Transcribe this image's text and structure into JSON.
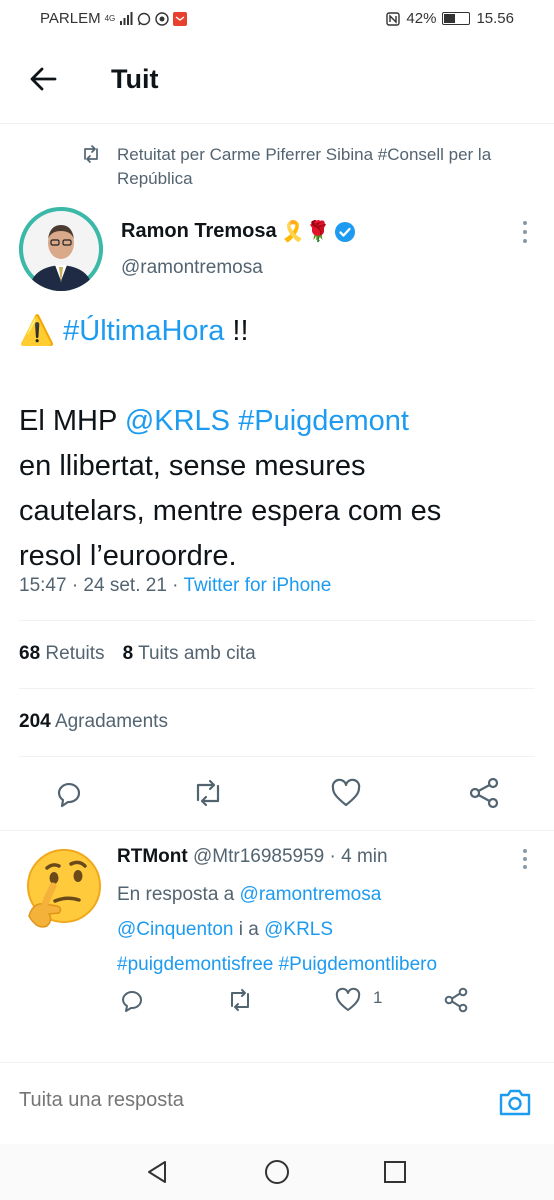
{
  "status_bar": {
    "carrier": "PARLEM",
    "network": "4G",
    "battery": "42%",
    "battery_level": 0.42,
    "time": "15.56"
  },
  "header": {
    "title": "Tuit"
  },
  "retweet": {
    "text": "Retuitat per Carme Piferrer Sibina #Consell per la República"
  },
  "tweet": {
    "author_name": "Ramon Tremosa",
    "author_emoji": "🎗️🌹",
    "author_handle": "@ramontremosa",
    "warning_emoji": "⚠️",
    "hashtag_breaking": "#ÚltimaHora",
    "exclaim": " !!",
    "line2_prefix": "El MHP ",
    "mention_krls": "@KRLS",
    "hashtag_puigdemont": "#Puigdemont",
    "line3": "en llibertat, sense mesures",
    "line4": "cautelars, mentre espera com es",
    "line5": "resol l’euroordre.",
    "meta_time": "15:47 · 24 set. 21 · ",
    "meta_source": "Twitter for iPhone"
  },
  "stats": {
    "retweets_count": "68",
    "retweets_label": "Retuits",
    "quotes_count": "8",
    "quotes_label": "Tuits amb cita",
    "likes_count": "204",
    "likes_label": "Agradaments"
  },
  "reply": {
    "author_name": "RTMont",
    "author_handle": "@Mtr16985959",
    "time": " · 4 min",
    "in_reply_prefix": "En resposta a ",
    "mention1": "@ramontremosa",
    "mention2": "@Cinquenton",
    "and_text": " i a ",
    "mention3": "@KRLS",
    "hashtag1": "#puigdemontisfree",
    "hashtag2": "#Puigdemontlibero",
    "like_count": "1"
  },
  "compose": {
    "placeholder": "Tuita una resposta"
  },
  "colors": {
    "link": "#1d9bf0",
    "text_secondary": "#536471",
    "avatar_ring": "#3bb8a8"
  }
}
